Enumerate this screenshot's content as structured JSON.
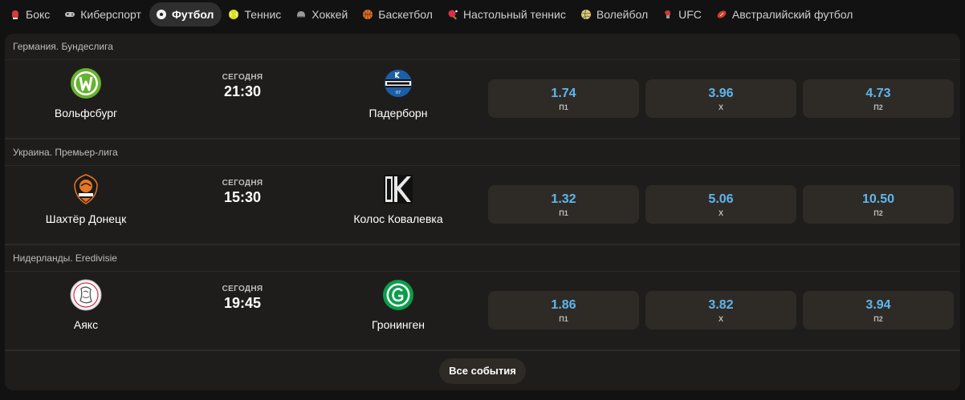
{
  "sports_tabs": [
    {
      "label": "Бокс",
      "icon": "boxing-glove-icon",
      "active": false
    },
    {
      "label": "Киберспорт",
      "icon": "gamepad-icon",
      "active": false
    },
    {
      "label": "Футбол",
      "icon": "soccer-ball-icon",
      "active": true
    },
    {
      "label": "Теннис",
      "icon": "tennis-ball-icon",
      "active": false
    },
    {
      "label": "Хоккей",
      "icon": "hockey-helmet-icon",
      "active": false
    },
    {
      "label": "Баскетбол",
      "icon": "basketball-icon",
      "active": false
    },
    {
      "label": "Настольный теннис",
      "icon": "ping-pong-paddle-icon",
      "active": false
    },
    {
      "label": "Волейбол",
      "icon": "volleyball-icon",
      "active": false
    },
    {
      "label": "UFC",
      "icon": "mma-glove-icon",
      "active": false
    },
    {
      "label": "Австралийский футбол",
      "icon": "rugby-ball-icon",
      "active": false
    }
  ],
  "events": [
    {
      "league": "Германия. Бундеслига",
      "home": {
        "name": "Вольфсбург",
        "logo": "wolfsburg-logo"
      },
      "day": "СЕГОДНЯ",
      "time": "21:30",
      "away": {
        "name": "Падерборн",
        "logo": "paderborn-logo"
      },
      "odds": [
        {
          "value": "1.74",
          "label": "П1"
        },
        {
          "value": "3.96",
          "label": "X"
        },
        {
          "value": "4.73",
          "label": "П2"
        }
      ]
    },
    {
      "league": "Украина. Премьер-лига",
      "home": {
        "name": "Шахтёр Донецк",
        "logo": "shakhtar-logo"
      },
      "day": "СЕГОДНЯ",
      "time": "15:30",
      "away": {
        "name": "Колос Ковалевка",
        "logo": "kolos-logo"
      },
      "odds": [
        {
          "value": "1.32",
          "label": "П1"
        },
        {
          "value": "5.06",
          "label": "X"
        },
        {
          "value": "10.50",
          "label": "П2"
        }
      ]
    },
    {
      "league": "Нидерланды. Eredivisie",
      "home": {
        "name": "Аякс",
        "logo": "ajax-logo"
      },
      "day": "СЕГОДНЯ",
      "time": "19:45",
      "away": {
        "name": "Гронинген",
        "logo": "groningen-logo"
      },
      "odds": [
        {
          "value": "1.86",
          "label": "П1"
        },
        {
          "value": "3.82",
          "label": "X"
        },
        {
          "value": "3.94",
          "label": "П2"
        }
      ]
    }
  ],
  "all_events_label": "Все события",
  "colors": {
    "odd_value": "#5fb6ef",
    "panel_bg": "#1f1d1c",
    "odd_bg": "#2e2b26",
    "active_tab_bg": "#2f2f2f"
  }
}
